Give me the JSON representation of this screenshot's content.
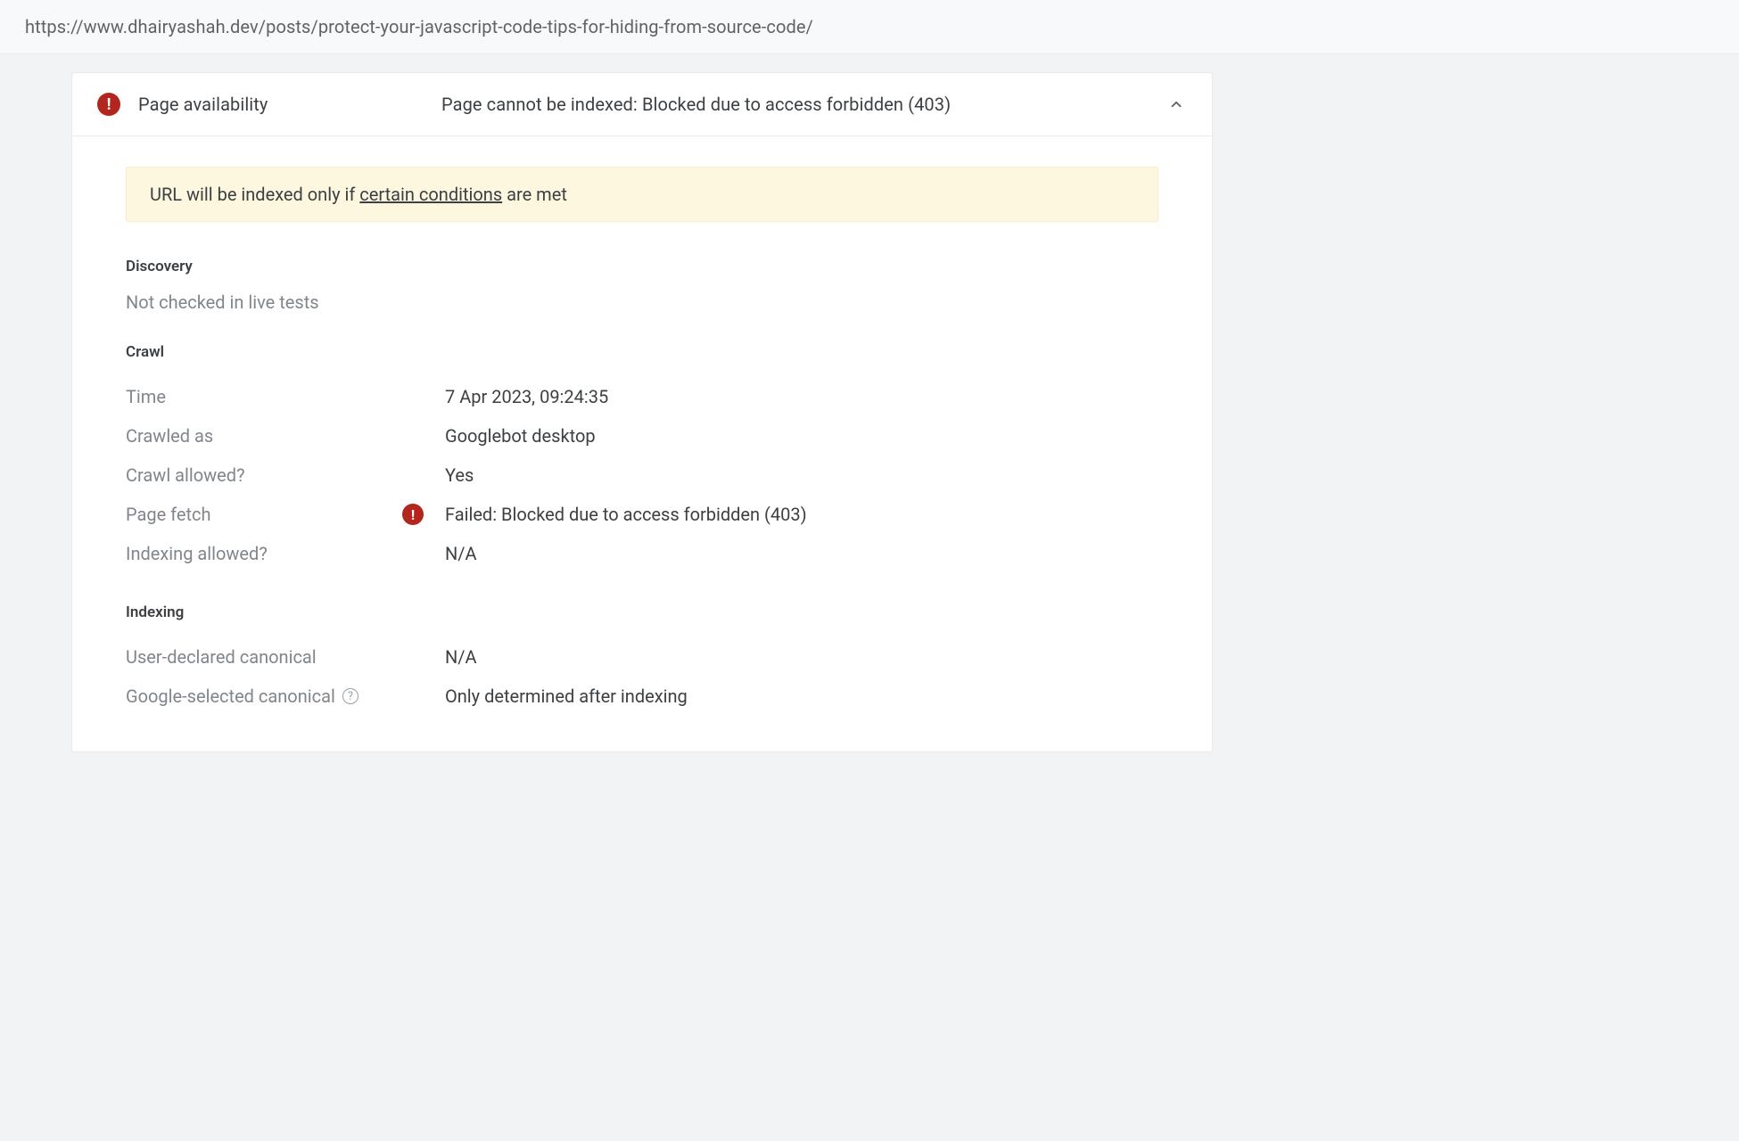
{
  "url": "https://www.dhairyashah.dev/posts/protect-your-javascript-code-tips-for-hiding-from-source-code/",
  "section": {
    "title": "Page availability",
    "summary": "Page cannot be indexed: Blocked due to access forbidden (403)"
  },
  "notice": {
    "prefix": "URL will be indexed only if ",
    "link_text": "certain conditions",
    "suffix": " are met"
  },
  "discovery": {
    "heading": "Discovery",
    "status": "Not checked in live tests"
  },
  "crawl": {
    "heading": "Crawl",
    "rows": [
      {
        "label": "Time",
        "value": "7 Apr 2023, 09:24:35",
        "error": false
      },
      {
        "label": "Crawled as",
        "value": "Googlebot desktop",
        "error": false
      },
      {
        "label": "Crawl allowed?",
        "value": "Yes",
        "error": false
      },
      {
        "label": "Page fetch",
        "value": "Failed: Blocked due to access forbidden (403)",
        "error": true
      },
      {
        "label": "Indexing allowed?",
        "value": "N/A",
        "error": false
      }
    ]
  },
  "indexing": {
    "heading": "Indexing",
    "rows": [
      {
        "label": "User-declared canonical",
        "value": "N/A",
        "help": false
      },
      {
        "label": "Google-selected canonical",
        "value": "Only determined after indexing",
        "help": true
      }
    ]
  }
}
